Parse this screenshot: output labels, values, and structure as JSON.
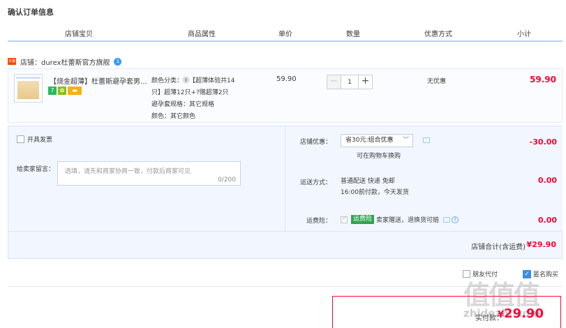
{
  "page": {
    "title": "确认订单信息"
  },
  "columns": [
    "店铺宝贝",
    "商品属性",
    "单价",
    "数量",
    "优惠方式",
    "小计"
  ],
  "shop": {
    "label": "店铺：durex杜蕾斯官方旗舰",
    "badge": "1",
    "tag": "天猫"
  },
  "item": {
    "title": "【烧金超薄】杜蕾斯避孕套男用...",
    "attrs": [
      "颜色分类：⓪【超薄体验共14",
      "只】超薄12只+?赠超薄2只",
      "避孕套规格：其它规格",
      "颜色：其它颜色"
    ],
    "price": "59.90",
    "quantity": "1",
    "minus": "−",
    "plus": "+",
    "discount": "无优惠",
    "subtotal": "59.90",
    "icons": [
      "seven-day-return-icon",
      "flower-icon",
      "credit-card-icon"
    ],
    "icon_seven": "7"
  },
  "invoice": {
    "label": "开具发票"
  },
  "message": {
    "label": "给卖家留言：",
    "placeholder": "选填，请先和商家协商一致，付款后商家可见",
    "count": "0/200"
  },
  "promo": {
    "label": "店铺优惠：",
    "selected": "省30元:组合优惠",
    "chevron": "﹀",
    "note": "可在购物车换购",
    "amount": "-30.00"
  },
  "shipping": {
    "label": "运送方式：",
    "line1": "普通配送 快递 免邮",
    "line2": "16:00前付款，今天发货",
    "amount": "0.00"
  },
  "insurance": {
    "label": "运费险：",
    "badge": "运费险",
    "text": "卖家赠送，退换货可赔",
    "help": "?",
    "amount": "0.00"
  },
  "shop_total": {
    "label": "店铺合计(含运费)",
    "value": "¥29.90"
  },
  "options": {
    "anonymous_friend": "朋友代付",
    "anonymous_buy": "匿名购买"
  },
  "payment": {
    "label": "实付款：",
    "currency": "¥",
    "value": "29.90"
  },
  "watermark": {
    "text": "值值值",
    "url": "zhidezhi.com"
  },
  "colors": {
    "accent_red": "#ff0036",
    "border_blue": "#b2d1ff",
    "panel_bg": "#f2f7ff"
  }
}
